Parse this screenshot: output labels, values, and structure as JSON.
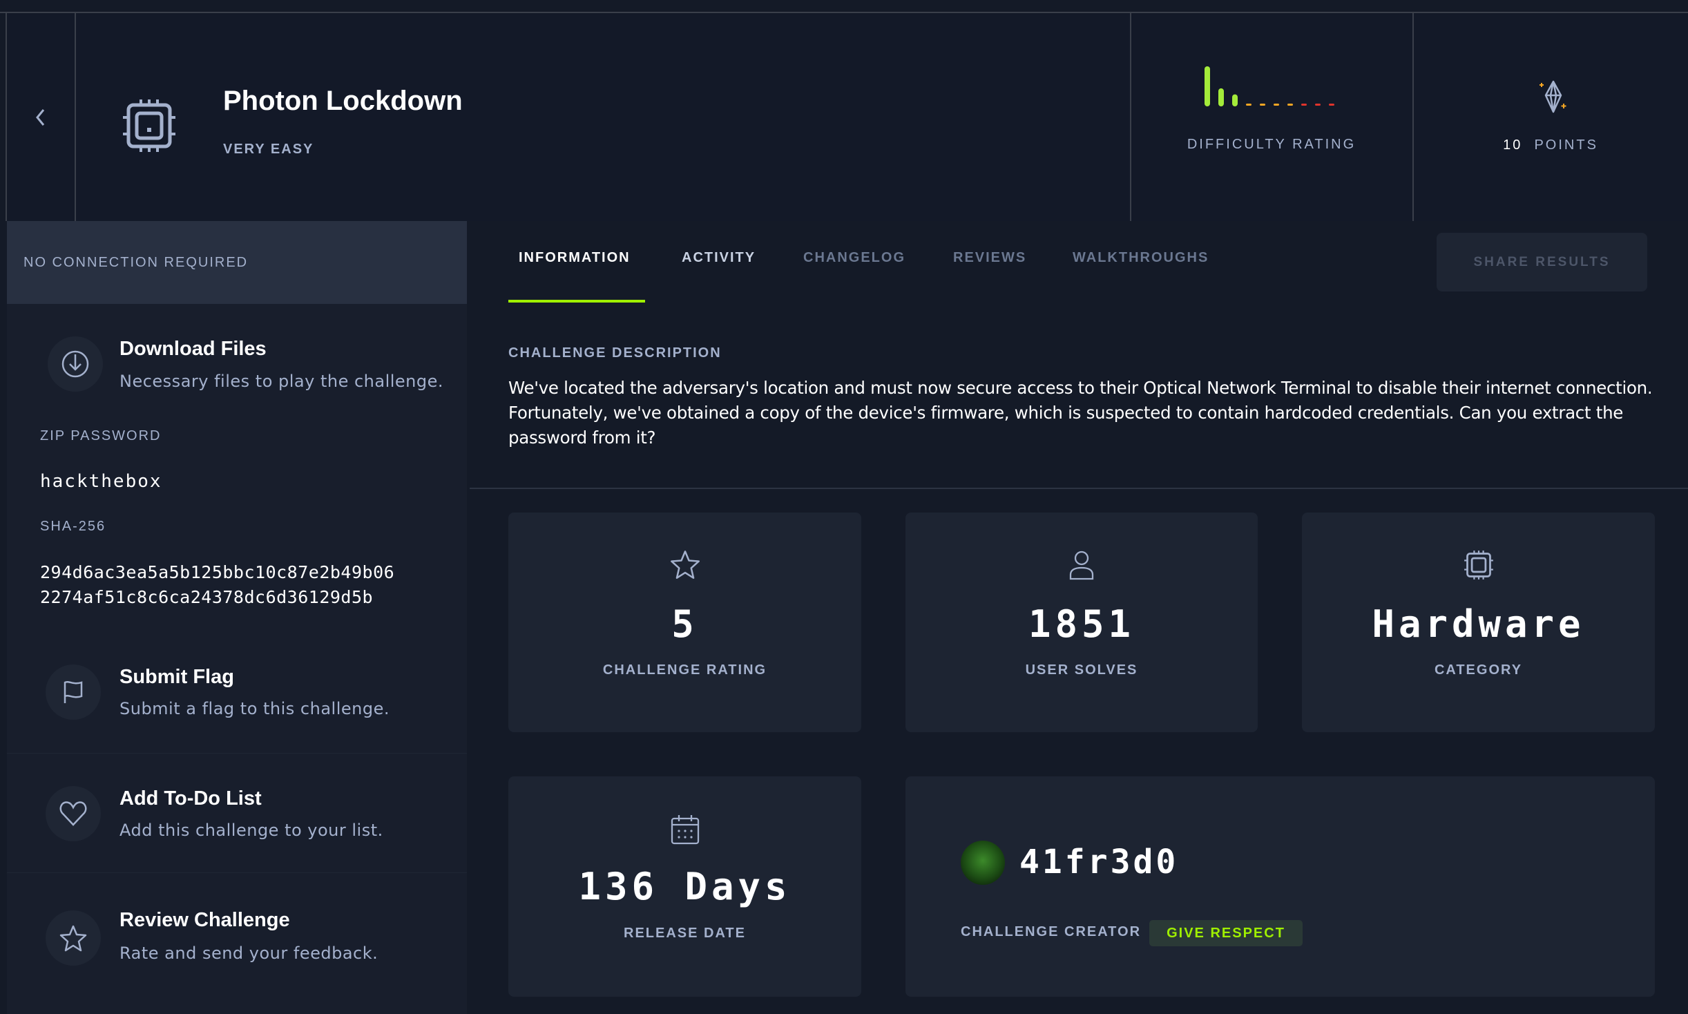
{
  "header": {
    "title": "Photon Lockdown",
    "difficulty": "VERY EASY",
    "difficulty_label": "DIFFICULTY RATING",
    "points_value": "10",
    "points_label": "POINTS"
  },
  "difficulty_chart": {
    "type": "bar",
    "values": [
      1,
      0.45,
      0.3,
      0,
      0,
      0,
      0,
      0,
      0,
      0
    ],
    "colors": [
      "#a4eb3a",
      "#a4eb3a",
      "#a4eb3a",
      "#f5a623",
      "#f5a623",
      "#f5a623",
      "#f5a623",
      "#e0342c",
      "#e0342c",
      "#e0342c"
    ]
  },
  "sidebar": {
    "connection": "NO CONNECTION REQUIRED",
    "download": {
      "title": "Download Files",
      "desc": "Necessary files to play the challenge."
    },
    "zip_label": "ZIP PASSWORD",
    "zip_value": "hackthebox",
    "sha_label": "SHA-256",
    "sha_line1": "294d6ac3ea5a5b125bbc10c87e2b49b06",
    "sha_line2": "2274af51c8c6ca24378dc6d36129d5b",
    "items": [
      {
        "title": "Submit Flag",
        "desc": "Submit a flag to this challenge.",
        "icon": "flag-icon"
      },
      {
        "title": "Add To-Do List",
        "desc": "Add this challenge to your list.",
        "icon": "heart-icon"
      },
      {
        "title": "Review Challenge",
        "desc": "Rate and send your feedback.",
        "icon": "star-icon"
      }
    ]
  },
  "tabs": [
    {
      "label": "INFORMATION",
      "active": true
    },
    {
      "label": "ACTIVITY"
    },
    {
      "label": "CHANGELOG"
    },
    {
      "label": "REVIEWS"
    },
    {
      "label": "WALKTHROUGHS"
    }
  ],
  "share_label": "SHARE RESULTS",
  "description": {
    "label": "CHALLENGE DESCRIPTION",
    "line1": "We've located the adversary's location and must now secure access to their Optical Network Terminal to disable their internet connection.",
    "line2": "Fortunately, we've obtained a copy of the device's firmware, which is suspected to contain hardcoded credentials. Can you extract the",
    "line3": "password from it?"
  },
  "stats": [
    {
      "value": "5",
      "label": "CHALLENGE RATING",
      "icon": "star-icon"
    },
    {
      "value": "1851",
      "label": "USER SOLVES",
      "icon": "user-icon"
    },
    {
      "value": "Hardware",
      "label": "CATEGORY",
      "icon": "chip-icon"
    },
    {
      "value": "136 Days",
      "label": "RELEASE DATE",
      "icon": "calendar-icon"
    }
  ],
  "creator": {
    "name": "41fr3d0",
    "label": "CHALLENGE CREATOR",
    "respect": "GIVE RESPECT"
  },
  "colors": {
    "accent": "#9fef00",
    "background": "#141a27",
    "card": "#1d2432"
  }
}
